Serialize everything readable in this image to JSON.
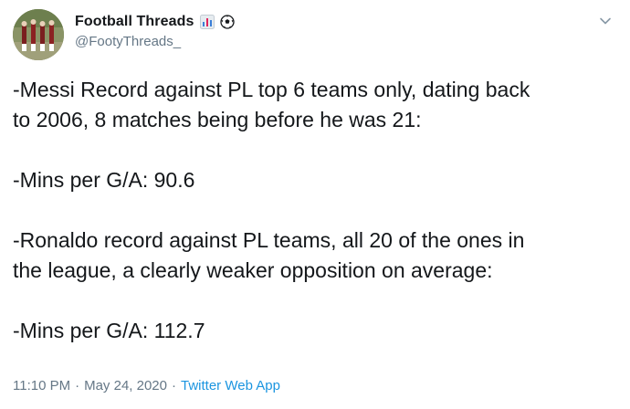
{
  "user": {
    "display_name": "Football Threads",
    "handle": "@FootyThreads_",
    "name_icons": [
      "bar-chart-icon",
      "soccer-ball-icon"
    ]
  },
  "tweet": {
    "paragraphs": [
      "-Messi Record against PL top 6 teams only, dating back\nto 2006, 8 matches being before he was 21:",
      "-Mins per G/A: 90.6",
      "-Ronaldo record against PL teams, all 20 of the ones in\nthe league, a clearly weaker opposition on average:",
      "-Mins per G/A: 112.7"
    ]
  },
  "meta": {
    "time": "11:10 PM",
    "date": "May 24, 2020",
    "separator": "·",
    "source": "Twitter Web App"
  },
  "colors": {
    "text": "#14171a",
    "secondary": "#657786",
    "link": "#1b95e0"
  }
}
